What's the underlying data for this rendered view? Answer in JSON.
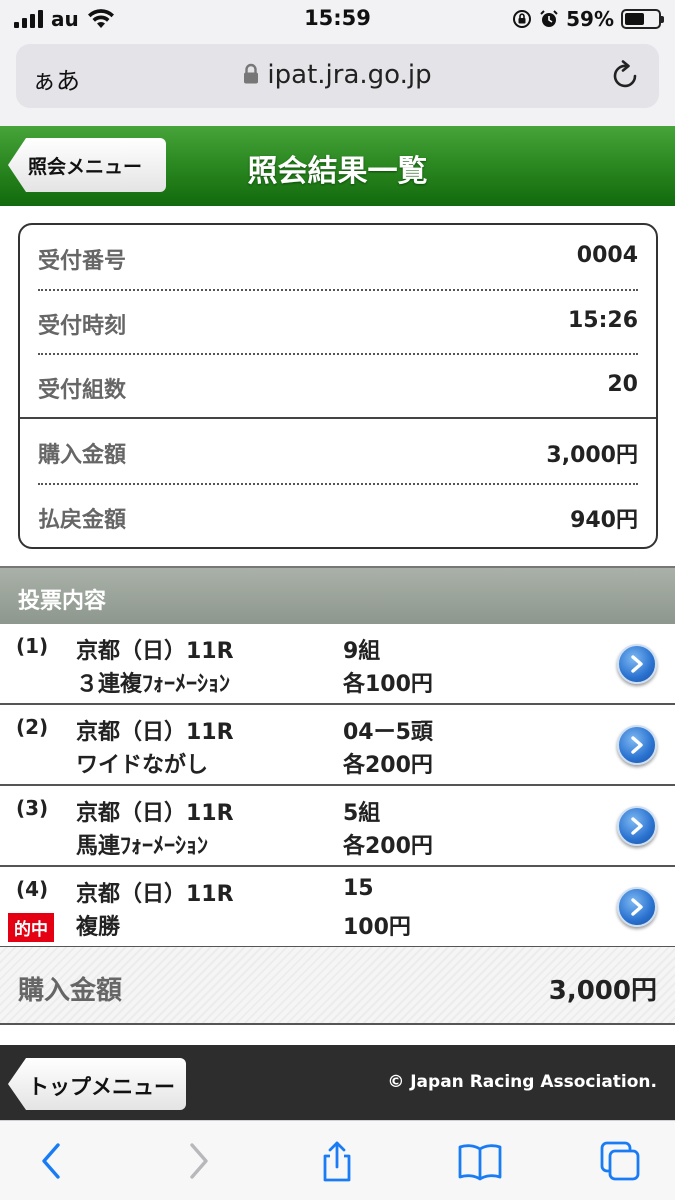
{
  "status_bar": {
    "carrier": "au",
    "time": "15:59",
    "battery_percent": "59%",
    "battery_level": 0.59
  },
  "browser": {
    "aa_label": "ぁあ",
    "url": "ipat.jra.go.jp"
  },
  "header": {
    "back_label": "照会メニュー",
    "title": "照会結果一覧"
  },
  "summary": {
    "rows": [
      {
        "label": "受付番号",
        "value": "0004"
      },
      {
        "label": "受付時刻",
        "value": "15:26"
      },
      {
        "label": "受付組数",
        "value": "20"
      },
      {
        "label": "購入金額",
        "value": "3,000円"
      },
      {
        "label": "払戻金額",
        "value": "940円"
      }
    ]
  },
  "section": {
    "title": "投票内容"
  },
  "bets": [
    {
      "num": "(1)",
      "venue": "京都（日）11R",
      "type": "３連複ﾌｫｰﾒｰｼｮﾝ",
      "detail": "9組",
      "amount": "各100円",
      "hit": ""
    },
    {
      "num": "(2)",
      "venue": "京都（日）11R",
      "type": "ワイドながし",
      "detail": "04ー5頭",
      "amount": "各200円",
      "hit": ""
    },
    {
      "num": "(3)",
      "venue": "京都（日）11R",
      "type": "馬連ﾌｫｰﾒｰｼｮﾝ",
      "detail": "5組",
      "amount": "各200円",
      "hit": ""
    },
    {
      "num": "(4)",
      "venue": "京都（日）11R",
      "type": "複勝",
      "detail": "15",
      "amount": "100円",
      "hit": "的中"
    }
  ],
  "total": {
    "label": "購入金額",
    "value": "3,000円"
  },
  "footer": {
    "top_menu_label": "トップメニュー",
    "copyright": "© Japan Racing Association."
  },
  "colors": {
    "header_green": "#2d8a22",
    "hit_red": "#e40012",
    "arrow_blue": "#2a72d0",
    "ios_blue": "#1a7cf5"
  }
}
